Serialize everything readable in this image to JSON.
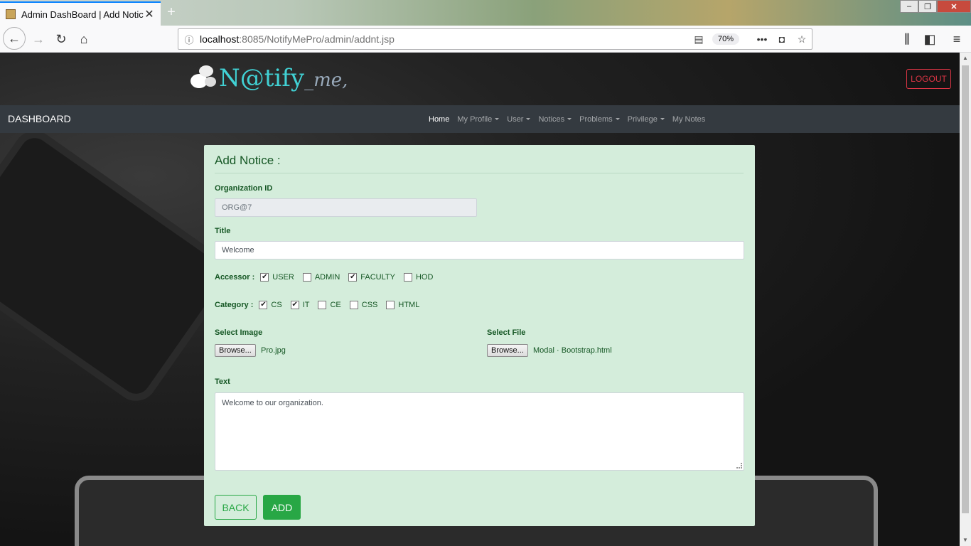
{
  "browser": {
    "tab_title": "Admin DashBoard | Add Notice",
    "url_host": "localhost",
    "url_path": ":8085/NotifyMePro/admin/addnt.jsp",
    "zoom": "70%"
  },
  "header": {
    "logo_main": "N@tify",
    "logo_suffix": "_me,",
    "logout_label": "LOGOUT"
  },
  "nav": {
    "brand": "DASHBOARD",
    "items": [
      {
        "label": "Home"
      },
      {
        "label": "My Profile"
      },
      {
        "label": "User"
      },
      {
        "label": "Notices"
      },
      {
        "label": "Problems"
      },
      {
        "label": "Privilege"
      },
      {
        "label": "My Notes"
      }
    ]
  },
  "form": {
    "title": "Add Notice :",
    "org_label": "Organization ID",
    "org_value": "ORG@7",
    "title_label": "Title",
    "title_value": "Welcome",
    "accessor_label": "Accessor :",
    "accessors": [
      {
        "label": "USER",
        "checked": "✔"
      },
      {
        "label": "ADMIN",
        "checked": ""
      },
      {
        "label": "FACULTY",
        "checked": "✔"
      },
      {
        "label": "HOD",
        "checked": ""
      }
    ],
    "category_label": "Category :",
    "categories": [
      {
        "label": "CS",
        "checked": "✔"
      },
      {
        "label": "IT",
        "checked": "✔"
      },
      {
        "label": "CE",
        "checked": ""
      },
      {
        "label": "CSS",
        "checked": ""
      },
      {
        "label": "HTML",
        "checked": ""
      }
    ],
    "image_label": "Select Image",
    "image_browse": "Browse...",
    "image_file": "Pro.jpg",
    "file_label": "Select File",
    "file_browse": "Browse...",
    "file_name": "Modal · Bootstrap.html",
    "text_label": "Text",
    "text_value": "Welcome to our organization.",
    "back_label": "BACK",
    "add_label": "ADD"
  },
  "colors": {
    "card_bg": "#d4eddb",
    "success": "#28a745",
    "danger": "#dc3545",
    "nav_bg": "#343a40"
  }
}
